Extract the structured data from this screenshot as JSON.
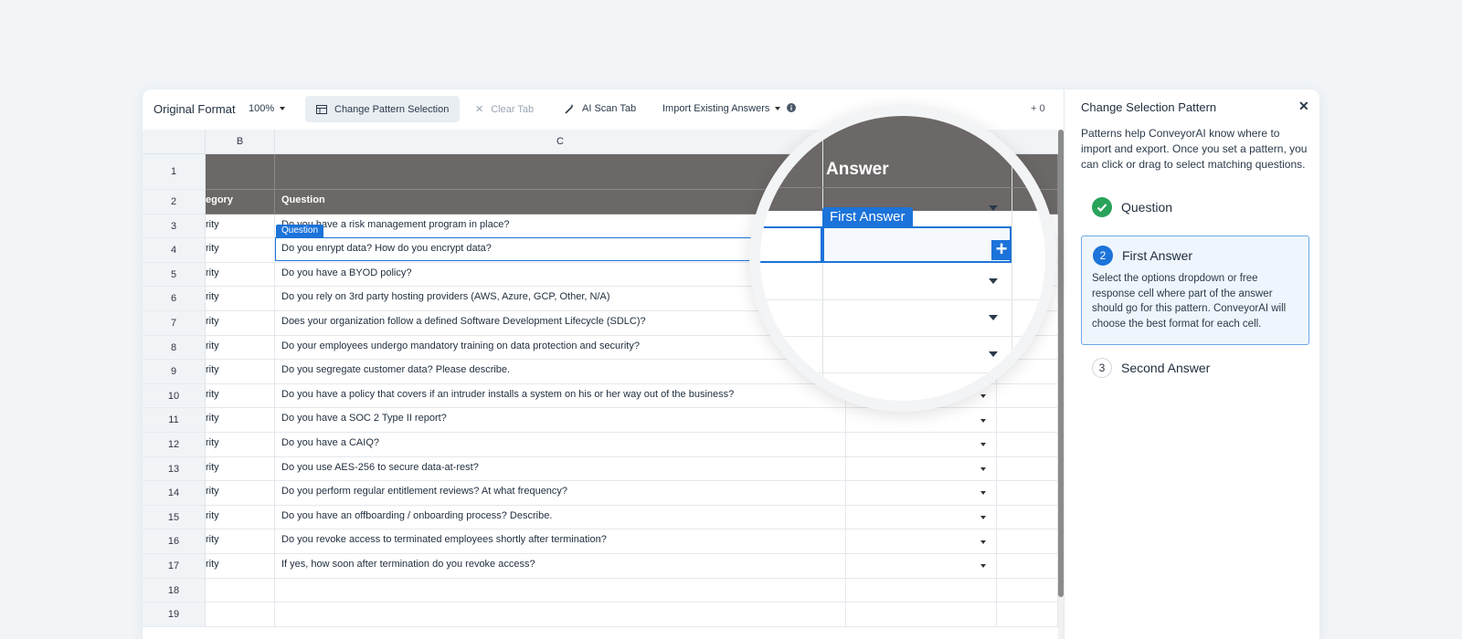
{
  "toolbar": {
    "title": "Original Format",
    "zoom": "100%",
    "change_pattern": "Change Pattern Selection",
    "clear_tab": "Clear Tab",
    "ai_scan": "AI Scan Tab",
    "import_answers": "Import Existing Answers",
    "count": "+ 0"
  },
  "columns": [
    "B",
    "C"
  ],
  "row_numbers": [
    "1",
    "2",
    "3",
    "4",
    "5",
    "6",
    "7",
    "8",
    "9",
    "10",
    "11",
    "12",
    "13",
    "14",
    "15",
    "16",
    "17",
    "18",
    "19"
  ],
  "header_row": {
    "category": "egory",
    "question": "Question"
  },
  "rows": [
    {
      "category": "rity",
      "question": "Do you have a risk management program in place?"
    },
    {
      "category": "rity",
      "question": "Do you enrypt data? How do you encrypt data?"
    },
    {
      "category": "rity",
      "question": "Do you have a BYOD policy?"
    },
    {
      "category": "rity",
      "question": "Do you rely on 3rd party hosting providers (AWS, Azure, GCP, Other, N/A)"
    },
    {
      "category": "rity",
      "question": "Does your organization follow a defined Software Development Lifecycle (SDLC)?"
    },
    {
      "category": "rity",
      "question": "Do your employees undergo mandatory training on data protection and security?"
    },
    {
      "category": "rity",
      "question": "Do you segregate customer data? Please describe."
    },
    {
      "category": "rity",
      "question": "Do you have a policy that covers if an intruder installs a system on his or her way out of the business?"
    },
    {
      "category": "rity",
      "question": "Do you have a SOC 2 Type II report?"
    },
    {
      "category": "rity",
      "question": "Do you have a CAIQ?"
    },
    {
      "category": "rity",
      "question": "Do you use AES-256 to secure data-at-rest?"
    },
    {
      "category": "rity",
      "question": "Do you perform regular entitlement reviews? At what frequency?"
    },
    {
      "category": "rity",
      "question": "Do you have an offboarding / onboarding process? Describe."
    },
    {
      "category": "rity",
      "question": "Do you revoke access to terminated employees shortly after termination?"
    },
    {
      "category": "rity",
      "question": "If yes, how soon after termination do you revoke access?"
    }
  ],
  "question_tag": "Question",
  "magnifier": {
    "answer_header": "Answer",
    "first_answer_tag": "First Answer"
  },
  "panel": {
    "title": "Change Selection Pattern",
    "description": "Patterns help ConveyorAI know where to import and export. Once you set a pattern, you can click or drag to select matching questions.",
    "steps": [
      {
        "number": "1",
        "label": "Question",
        "status": "done"
      },
      {
        "number": "2",
        "label": "First Answer",
        "status": "active",
        "description": "Select the options dropdown or free response cell where part of the answer should go for this pattern. ConveyorAI will choose the best format for each cell."
      },
      {
        "number": "3",
        "label": "Second Answer",
        "status": "pending"
      }
    ]
  },
  "colors": {
    "accent": "#1c73d9",
    "header_dark": "#6b6867",
    "success": "#29a35a"
  }
}
